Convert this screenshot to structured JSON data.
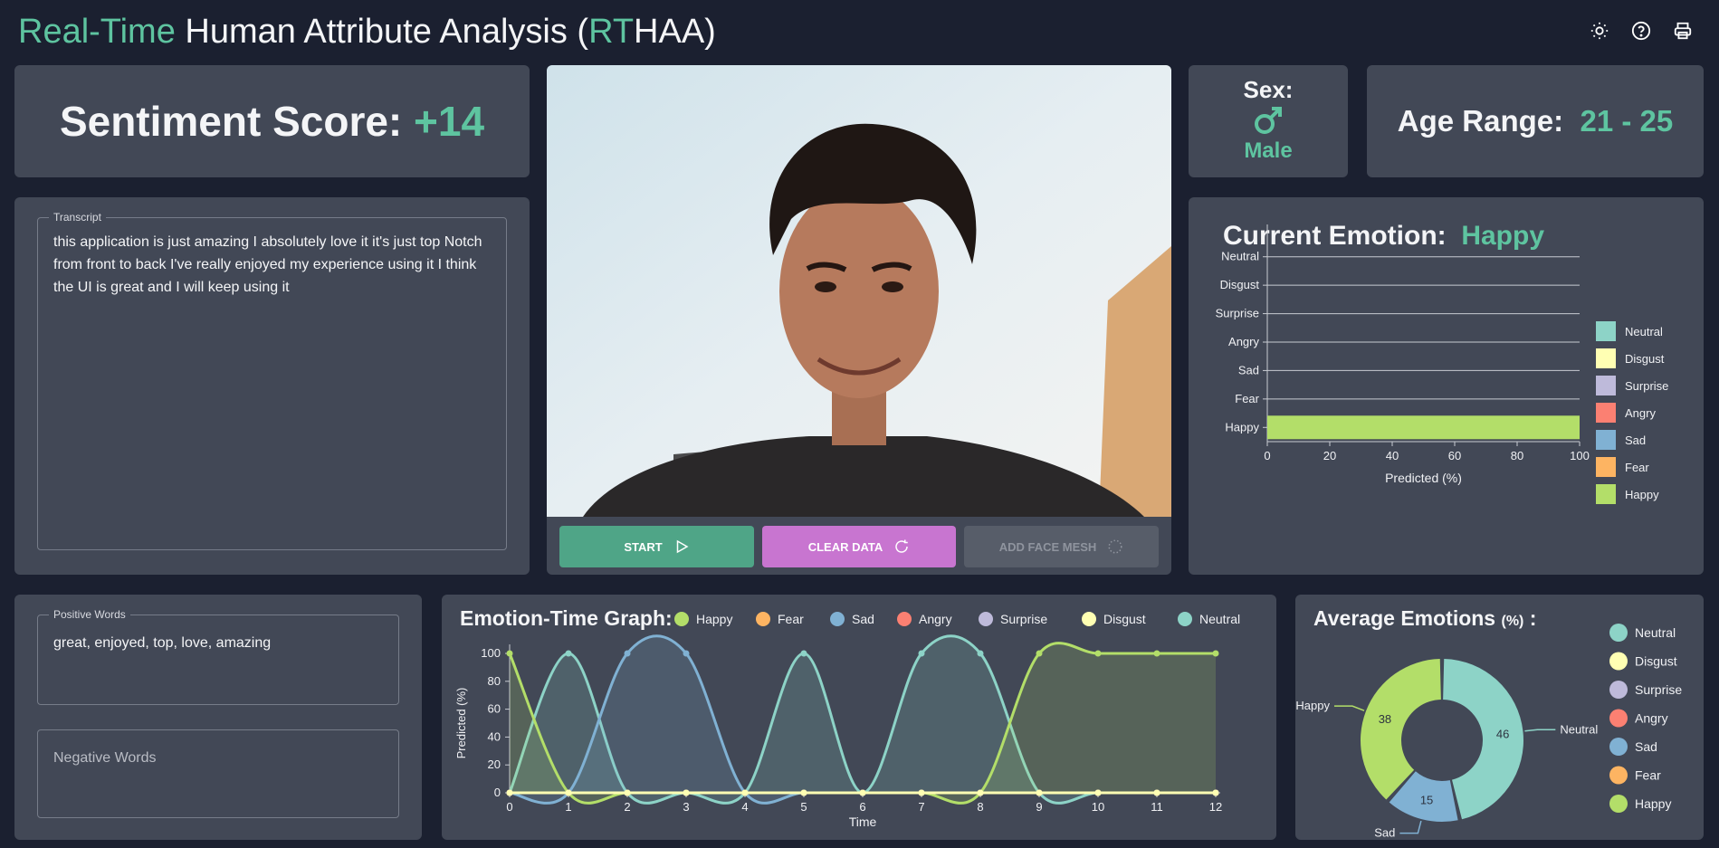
{
  "header": {
    "title_part1": "Real-Time",
    "title_part2": " Human Attribute Analysis (",
    "title_part3": "RT",
    "title_part4": "HAA)",
    "icons": [
      "sun-icon",
      "help-circle-icon",
      "printer-icon"
    ]
  },
  "sentiment": {
    "label": "Sentiment Score:",
    "value": "+14"
  },
  "sex": {
    "label": "Sex:",
    "icon": "male-symbol-icon",
    "value": "Male"
  },
  "age": {
    "label": "Age Range:",
    "value": "21 - 25"
  },
  "transcript": {
    "label": "Transcript",
    "text": "this application is just amazing I absolutely love it it's just top Notch from front to back I've really enjoyed my experience using it I think the UI is great and I will keep using it"
  },
  "positive_words": {
    "label": "Positive Words",
    "text": "great, enjoyed, top, love, amazing"
  },
  "negative_words": {
    "placeholder": "Negative Words"
  },
  "controls": {
    "start_label": "START",
    "clear_label": "CLEAR DATA",
    "mesh_label": "ADD FACE MESH"
  },
  "current_emotion": {
    "label": "Current Emotion:",
    "value": "Happy"
  },
  "emotion_time": {
    "title": "Emotion-Time Graph:"
  },
  "average": {
    "title": "Average Emotions",
    "unit": "(%)",
    "suffix": ":"
  },
  "colors": {
    "Neutral": "#8dd3c7",
    "Disgust": "#ffffb3",
    "Surprise": "#bebada",
    "Angry": "#fb8072",
    "Sad": "#80b1d3",
    "Fear": "#fdb462",
    "Happy": "#b3de69",
    "accent": "#5ec4a0",
    "start_button": "#4fa587",
    "clear_button": "#c875d0",
    "mesh_button": "#575d69"
  },
  "chart_data": [
    {
      "type": "bar",
      "orientation": "horizontal",
      "categories": [
        "Neutral",
        "Disgust",
        "Surprise",
        "Angry",
        "Sad",
        "Fear",
        "Happy"
      ],
      "values": [
        0,
        0,
        0,
        0,
        0,
        0,
        100
      ],
      "xlabel": "Predicted (%)",
      "xlim": [
        0,
        100
      ],
      "xticks": [
        0,
        20,
        40,
        60,
        80,
        100
      ],
      "legend": [
        "Neutral",
        "Disgust",
        "Surprise",
        "Angry",
        "Sad",
        "Fear",
        "Happy"
      ],
      "legend_position": "right"
    },
    {
      "type": "line",
      "x": [
        0,
        1,
        2,
        3,
        4,
        5,
        6,
        7,
        8,
        9,
        10,
        11,
        12
      ],
      "series": [
        {
          "name": "Happy",
          "values": [
            100,
            0,
            0,
            0,
            0,
            0,
            0,
            0,
            0,
            100,
            100,
            100,
            100
          ]
        },
        {
          "name": "Fear",
          "values": [
            0,
            0,
            0,
            0,
            0,
            0,
            0,
            0,
            0,
            0,
            0,
            0,
            0
          ]
        },
        {
          "name": "Sad",
          "values": [
            0,
            0,
            100,
            100,
            0,
            0,
            0,
            0,
            0,
            0,
            0,
            0,
            0
          ]
        },
        {
          "name": "Angry",
          "values": [
            0,
            0,
            0,
            0,
            0,
            0,
            0,
            0,
            0,
            0,
            0,
            0,
            0
          ]
        },
        {
          "name": "Surprise",
          "values": [
            0,
            0,
            0,
            0,
            0,
            0,
            0,
            0,
            0,
            0,
            0,
            0,
            0
          ]
        },
        {
          "name": "Disgust",
          "values": [
            0,
            0,
            0,
            0,
            0,
            0,
            0,
            0,
            0,
            0,
            0,
            0,
            0
          ]
        },
        {
          "name": "Neutral",
          "values": [
            0,
            100,
            0,
            0,
            0,
            100,
            0,
            100,
            100,
            0,
            0,
            0,
            0
          ]
        }
      ],
      "xlabel": "Time",
      "ylabel": "Predicted (%)",
      "ylim": [
        0,
        100
      ],
      "yticks": [
        0,
        20,
        40,
        60,
        80,
        100
      ],
      "legend_position": "top"
    },
    {
      "type": "pie",
      "style": "donut",
      "labels": [
        "Neutral",
        "Disgust",
        "Surprise",
        "Angry",
        "Sad",
        "Fear",
        "Happy"
      ],
      "values": [
        46,
        0,
        0,
        0,
        15,
        0,
        38
      ],
      "legend_position": "right"
    }
  ]
}
